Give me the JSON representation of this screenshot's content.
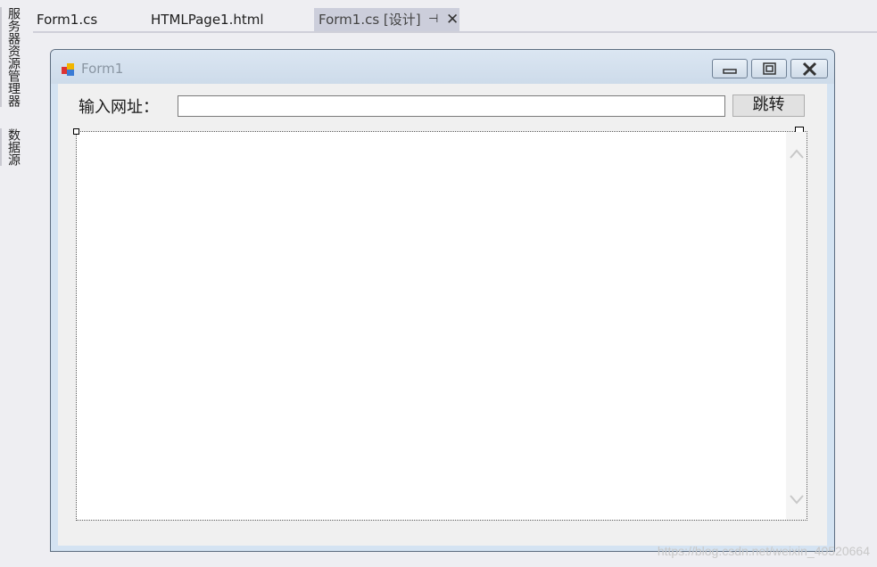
{
  "sidebar": {
    "items": [
      {
        "label": "服务器资源管理器"
      },
      {
        "label": "数据源"
      }
    ]
  },
  "tabs": [
    {
      "label": "Form1.cs"
    },
    {
      "label": "HTMLPage1.html"
    },
    {
      "label": "Form1.cs [设计]",
      "pinned": true,
      "active": true
    }
  ],
  "form": {
    "title": "Form1",
    "url_label": "输入网址：",
    "url_value": "",
    "go_button_label": "跳转"
  },
  "watermark": "https://blog.csdn.net/weixin_40520664",
  "colors": {
    "form_border": "#5d6d80",
    "titlebar": "#d4e3f2",
    "active_tab": "#cccedb",
    "designer_bg": "#eeeef2"
  }
}
